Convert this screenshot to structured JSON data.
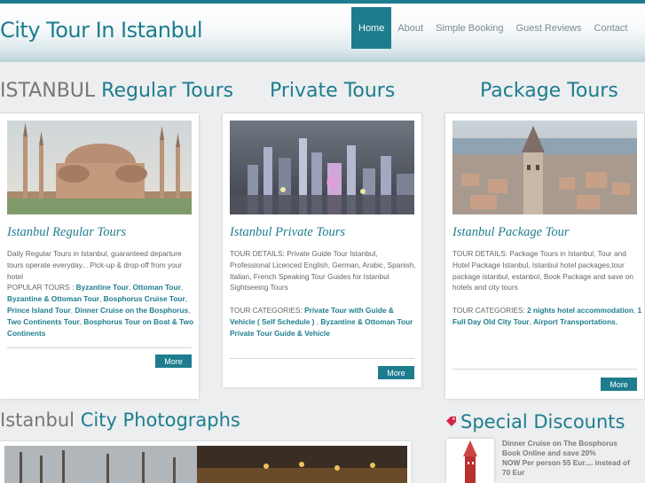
{
  "header": {
    "logo": "City Tour In Istanbul",
    "nav": [
      "Home",
      "About",
      "Simple Booking",
      "Guest Reviews",
      "Contact"
    ],
    "active_index": 0
  },
  "sections": {
    "regular_title_prefix": "ISTANBUL",
    "regular_title_rest": " Regular Tours",
    "private_title": "Private Tours",
    "package_title": "Package Tours",
    "photos_title_prefix": "Istanbul",
    "photos_title_rest": " City Photographs",
    "discounts_title": "Special Discounts"
  },
  "cards": [
    {
      "title": "Istanbul Regular Tours",
      "text1": "Daily Regular Tours in Istanbul, guaranteed departure tours operate everyday... Pick-up & drop-off from your hotel",
      "text2_label": "POPULAR TOURS : ",
      "links": [
        "Byzantine Tour",
        "Ottoman Tour",
        "Byzantine & Ottoman Tour",
        "Bosphorus Cruise Tour",
        "Prince Island Tour",
        "Dinner Cruise on the Bosphorus",
        "Two Continents Tour",
        "Bosphorus Tour on Boat & Two Continents"
      ],
      "button": "More"
    },
    {
      "title": "Istanbul Private Tours",
      "text1": "TOUR DETAILS: Private Guide Tour Istanbul, Professional Licenced English, German, Arabic, Spanish, Italian, French Speaking Tour Guides for Istanbul Sightseeing Tours",
      "text2_label": "TOUR CATEGORIES: ",
      "links": [
        "Private Tour with Guide & Vehicle ( Self Schedule )",
        "Byzantine & Ottoman Tour Private Tour Guide & Vehicle"
      ],
      "button": "More"
    },
    {
      "title": "Istanbul Package Tour",
      "text1": "TOUR DETAILS: Package Tours in Istanbul, Tour and Hotel Package Istanbul, Istanbul hotel packages,tour package istanbul, estanbol, Book Package and save on hotels and city tours",
      "text2_label": "TOUR CATEGORIES: ",
      "links": [
        "2 nights hotel accommodation",
        "1 Full Day Old City Tour",
        "Airport Transportations."
      ],
      "button": "More"
    }
  ],
  "discount": {
    "line1": "Dinner Cruise on The Bosphorus",
    "line2": "Book Online and save 20%",
    "line3": "NOW Per person 55 Eur.... instead of",
    "line4": "70 Eur"
  },
  "colors": {
    "accent": "#1d7d8e",
    "background": "#eceeef"
  }
}
